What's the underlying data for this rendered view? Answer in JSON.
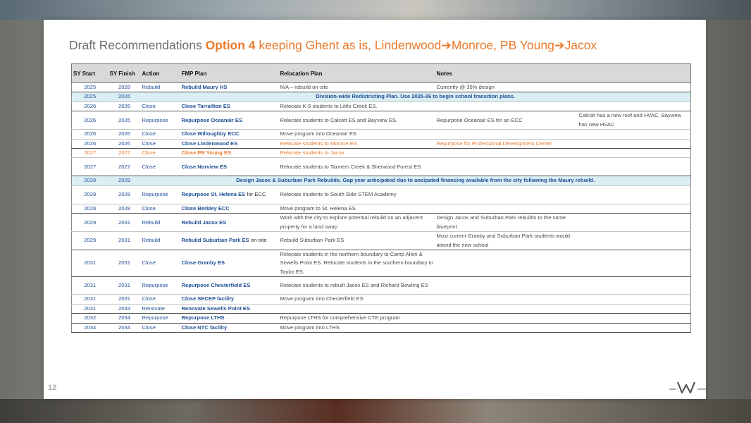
{
  "title": {
    "prefix": "Draft Recommendations ",
    "option": "Option 4",
    "rest": "  keeping Ghent as is, Lindenwood➔Monroe, PB Young➔Jacox"
  },
  "table": {
    "headers": [
      "SY Start",
      "SY Finish",
      "Action",
      "FMP Plan",
      "Relocation Plan",
      "Notes",
      ""
    ],
    "rows": [
      {
        "start": "2025",
        "finish": "2028",
        "action": "Rebuild",
        "plan": "Rebuild Maury HS",
        "relocation": "N/A – rebuild on-site",
        "notes": "Currently @ 35% design",
        "notes2": ""
      },
      {
        "start": "2025",
        "finish": "2026",
        "banner": "Division-wide Redistricting Plan.  Use 2025-26 to begin school transition plans."
      },
      {
        "start": "2026",
        "finish": "2026",
        "action": "Close",
        "plan": "Close Tarrallton ES",
        "relocation": "Relocate K-5 students to Little Creek ES.",
        "notes": "",
        "notes2": ""
      },
      {
        "start": "2026",
        "finish": "2026",
        "action": "Repurpose",
        "plan": "Repurpose Oceanair ES",
        "relocation": "Relocate students to Calcott ES and Bayview ES.",
        "notes": "Repurpose Oceanair ES for an ECC",
        "notes2": "Calcott has a new roof and HVAC, Bayview has new HVAC"
      },
      {
        "start": "2026",
        "finish": "2026",
        "action": "Close",
        "plan": "Close Willoughby ECC",
        "relocation": "Move program into Oceanair ES",
        "notes": "",
        "notes2": ""
      },
      {
        "start": "2026",
        "finish": "2026",
        "action": "Close",
        "plan": "Close Lindenwood ES",
        "relocation": "Relocate students to Monroe ES",
        "notes": "Repurpose for Professional Development Center",
        "notes2": ""
      },
      {
        "start": "2027",
        "finish": "2027",
        "action": "Close",
        "plan": "Close PB Young ES",
        "relocation": "Relocate students to Jacox",
        "notes": "",
        "notes2": ""
      },
      {
        "start": "2027",
        "finish": "2027",
        "action": "Close",
        "plan": "Close Norview ES",
        "relocation": "Relocate students to Tanners Creek & Sherwood Forest ES",
        "notes": "",
        "notes2": ""
      },
      {
        "start": "2028",
        "finish": "2029",
        "banner": "Design Jacox & Suburban Park Rebuilds.  Gap year anticipated due to ancipated financing available from the city following the Maury rebuild."
      },
      {
        "start": "2028",
        "finish": "2028",
        "action": "Repurpose",
        "plan": "Repurpose St. Helena ES",
        "plan_suffix": " for ECC",
        "relocation": "Relocate students to South Side STEM Academy",
        "notes": "",
        "notes2": ""
      },
      {
        "start": "2028",
        "finish": "2028",
        "action": "Close",
        "plan": "Close Berkley ECC",
        "relocation": "Move program to St. Helena ES",
        "notes": "",
        "notes2": ""
      },
      {
        "start": "2029",
        "finish": "2031",
        "action": "Rebuild",
        "plan": "Rebuild Jacox ES",
        "relocation": "Work with the city to explore potential rebuild on an adjacent property for a land swap",
        "notes": "Design Jacox and Suburban Park rebuilds to the same blueprint",
        "notes2": ""
      },
      {
        "start": "2029",
        "finish": "2031",
        "action": "Rebuild",
        "plan": "Rebuild Suburban Park ES",
        "plan_suffix": " on-site",
        "relocation": "Rebuild Suburban Park ES",
        "notes": "Most current Granby and Suburban Park students would attend the new school",
        "notes2": ""
      },
      {
        "start": "2031",
        "finish": "2031",
        "action": "Close",
        "plan": "Close Granby ES",
        "relocation": "Relocate students in the northern boundary to Camp Allen & Sewells Point ES.  Relocate students in the southern boundary to Taylor ES.",
        "notes": "",
        "notes2": ""
      },
      {
        "start": "2031",
        "finish": "2031",
        "action": "Repurpose",
        "plan": "Repurpose Chesterfield ES",
        "relocation": "Relocate students to rebuilt Jacox ES and Richard Bowling ES",
        "notes": "",
        "notes2": ""
      },
      {
        "start": "2031",
        "finish": "2031",
        "action": "Close",
        "plan": "Close SECEP facility",
        "relocation": "Move program into Chesterfield ES",
        "notes": "",
        "notes2": ""
      },
      {
        "start": "2031",
        "finish": "2033",
        "action": "Renovate",
        "plan": "Renovate Sewells Point ES",
        "relocation": "",
        "notes": "",
        "notes2": ""
      },
      {
        "start": "2032",
        "finish": "2034",
        "action": "Repurpose",
        "plan": "Repurpose LTHS",
        "relocation": "Repurpose LTHS for comprehensive CTE program",
        "notes": "",
        "notes2": ""
      },
      {
        "start": "2034",
        "finish": "2034",
        "action": "Close",
        "plan": "Close NTC facility",
        "relocation": "Move program into LTHS",
        "notes": "",
        "notes2": ""
      }
    ]
  },
  "page_number": "12",
  "logo_icon": "w-wave-logo-icon",
  "colors": {
    "accent": "#e8792a",
    "blue_text": "#1f4e96",
    "banner_bg": "#dbeef4",
    "header_bg": "#d9d9d9"
  }
}
